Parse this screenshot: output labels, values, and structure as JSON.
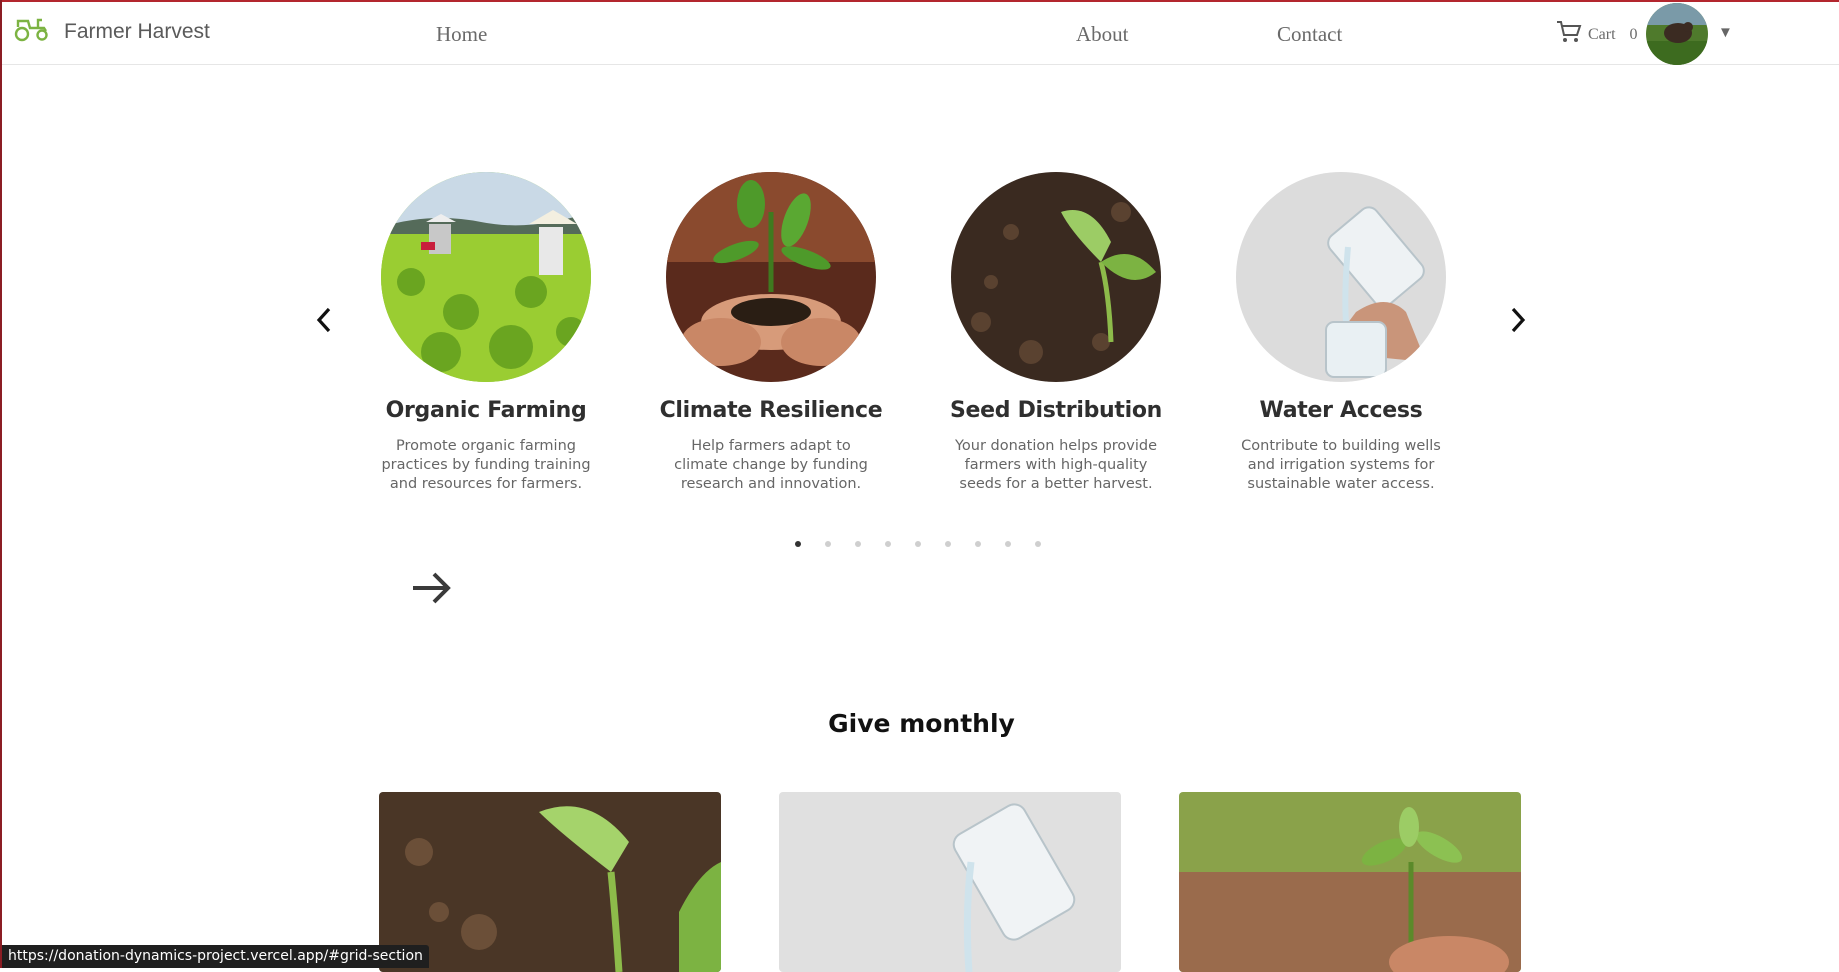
{
  "navbar": {
    "brand": "Farmer Harvest",
    "brand_icon": "tractor-icon",
    "links": [
      "Home",
      "About",
      "Contact"
    ],
    "cart_label": "Cart",
    "cart_count": "0",
    "dropdown_icon": "caret-down-icon"
  },
  "carousel": {
    "prev_icon": "chevron-left-icon",
    "next_icon": "chevron-right-icon",
    "cards": [
      {
        "title": "Organic Farming",
        "description": "Promote organic farming practices by funding training and resources for farmers."
      },
      {
        "title": "Climate Resilience",
        "description": "Help farmers adapt to climate change by funding research and innovation."
      },
      {
        "title": "Seed Distribution",
        "description": "Your donation helps provide farmers with high-quality seeds for a better harvest."
      },
      {
        "title": "Water Access",
        "description": "Contribute to building wells and irrigation systems for sustainable water access."
      }
    ],
    "dots_total": 9,
    "dot_active_index": 0
  },
  "arrow_icon": "arrow-right-icon",
  "section": {
    "title": "Give monthly"
  },
  "status_bar": {
    "url": "https://donation-dynamics-project.vercel.app/#grid-section"
  },
  "colors": {
    "accent": "#7cb342",
    "border_accent": "#b3262e",
    "text_muted": "#666666"
  }
}
